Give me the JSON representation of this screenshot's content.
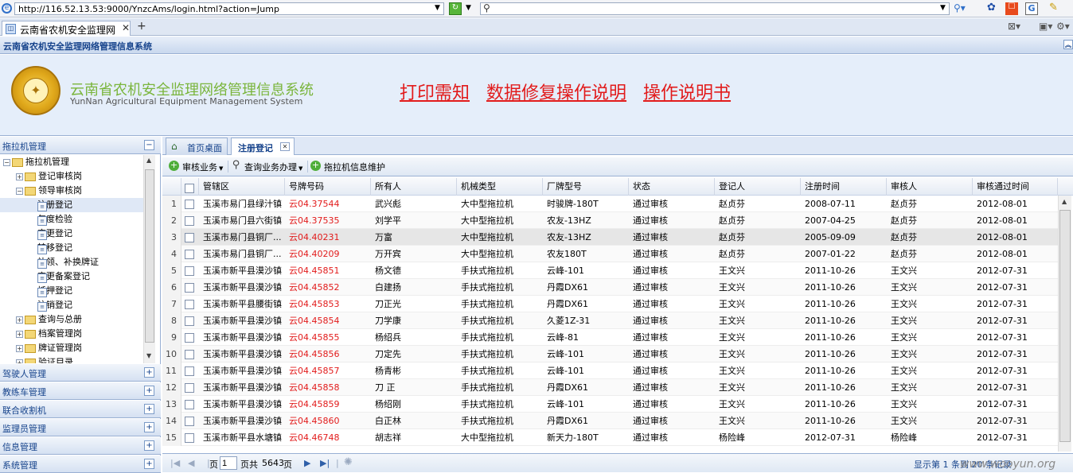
{
  "browser": {
    "url": "http://116.52.13.53:9000/YnzcAms/login.html?action=Jump",
    "tab_title": "云南省农机安全监理网"
  },
  "app": {
    "system_bar_title": "云南省农机安全监理网络管理信息系统",
    "title_cn": "云南省农机安全监理网络管理信息系统",
    "title_en": "YunNan Agricultural Equipment Management System",
    "header_links": [
      "打印需知",
      "数据修复操作说明",
      "操作说明书"
    ]
  },
  "sidebar": {
    "panels": [
      {
        "label": "拖拉机管理",
        "state": "−"
      },
      {
        "label": "驾驶人管理",
        "state": "+"
      },
      {
        "label": "教练车管理",
        "state": "+"
      },
      {
        "label": "联合收割机",
        "state": "+"
      },
      {
        "label": "监理员管理",
        "state": "+"
      },
      {
        "label": "信息管理",
        "state": "+"
      },
      {
        "label": "系统管理",
        "state": "+"
      }
    ],
    "tree": [
      {
        "label": "拖拉机管理",
        "level": 0,
        "type": "folder",
        "toggle": "−"
      },
      {
        "label": "登记审核岗",
        "level": 1,
        "type": "folder",
        "toggle": "+"
      },
      {
        "label": "领导审核岗",
        "level": 1,
        "type": "folder",
        "toggle": "−"
      },
      {
        "label": "注册登记",
        "level": 2,
        "type": "page",
        "selected": true
      },
      {
        "label": "年度检验",
        "level": 2,
        "type": "page"
      },
      {
        "label": "变更登记",
        "level": 2,
        "type": "page"
      },
      {
        "label": "转移登记",
        "level": 2,
        "type": "page"
      },
      {
        "label": "补领、补换牌证",
        "level": 2,
        "type": "page"
      },
      {
        "label": "变更备案登记",
        "level": 2,
        "type": "page"
      },
      {
        "label": "抵押登记",
        "level": 2,
        "type": "page"
      },
      {
        "label": "注销登记",
        "level": 2,
        "type": "page"
      },
      {
        "label": "查询与总册",
        "level": 1,
        "type": "folder",
        "toggle": "+"
      },
      {
        "label": "档案管理岗",
        "level": 1,
        "type": "folder",
        "toggle": "+"
      },
      {
        "label": "牌证管理岗",
        "level": 1,
        "type": "folder",
        "toggle": "+"
      },
      {
        "label": "验证目录",
        "level": 1,
        "type": "folder",
        "toggle": "+"
      }
    ]
  },
  "main_tabs": [
    {
      "label": "首页桌面"
    },
    {
      "label": "注册登记"
    }
  ],
  "toolbar": [
    {
      "label": "审核业务",
      "icon": "add-icon",
      "dropdown": true
    },
    {
      "label": "查询业务办理",
      "icon": "search-icon",
      "dropdown": true
    },
    {
      "label": "拖拉机信息维护",
      "icon": "add-icon",
      "dropdown": false
    }
  ],
  "grid": {
    "columns": [
      "管辖区",
      "号牌号码",
      "所有人",
      "机械类型",
      "厂牌型号",
      "状态",
      "登记人",
      "注册时间",
      "审核人",
      "审核通过时间"
    ],
    "rows": [
      [
        "玉溪市易门县绿汁镇",
        "云04.37544",
        "武兴彪",
        "大中型拖拉机",
        "时骏牌-180T",
        "通过审核",
        "赵贞芬",
        "2008-07-11",
        "赵贞芬",
        "2012-08-01"
      ],
      [
        "玉溪市易门县六街镇",
        "云04.37535",
        "刘学平",
        "大中型拖拉机",
        "农友-13HZ",
        "通过审核",
        "赵贞芬",
        "2007-04-25",
        "赵贞芬",
        "2012-08-01"
      ],
      [
        "玉溪市易门县铜厂...",
        "云04.40231",
        "万富",
        "大中型拖拉机",
        "农友-13HZ",
        "通过审核",
        "赵贞芬",
        "2005-09-09",
        "赵贞芬",
        "2012-08-01"
      ],
      [
        "玉溪市易门县铜厂...",
        "云04.40209",
        "万开宾",
        "大中型拖拉机",
        "农友180T",
        "通过审核",
        "赵贞芬",
        "2007-01-22",
        "赵贞芬",
        "2012-08-01"
      ],
      [
        "玉溪市新平县漠沙镇",
        "云04.45851",
        "杨文德",
        "手扶式拖拉机",
        "云峰-101",
        "通过审核",
        "王文兴",
        "2011-10-26",
        "王文兴",
        "2012-07-31"
      ],
      [
        "玉溪市新平县漠沙镇",
        "云04.45852",
        "白建扬",
        "手扶式拖拉机",
        "丹霞DX61",
        "通过审核",
        "王文兴",
        "2011-10-26",
        "王文兴",
        "2012-07-31"
      ],
      [
        "玉溪市新平县腰街镇",
        "云04.45853",
        "刀正光",
        "手扶式拖拉机",
        "丹霞DX61",
        "通过审核",
        "王文兴",
        "2011-10-26",
        "王文兴",
        "2012-07-31"
      ],
      [
        "玉溪市新平县漠沙镇",
        "云04.45854",
        "刀学康",
        "手扶式拖拉机",
        "久菱1Z-31",
        "通过审核",
        "王文兴",
        "2011-10-26",
        "王文兴",
        "2012-07-31"
      ],
      [
        "玉溪市新平县漠沙镇",
        "云04.45855",
        "杨绍兵",
        "手扶式拖拉机",
        "云峰-81",
        "通过审核",
        "王文兴",
        "2011-10-26",
        "王文兴",
        "2012-07-31"
      ],
      [
        "玉溪市新平县漠沙镇",
        "云04.45856",
        "刀定先",
        "手扶式拖拉机",
        "云峰-101",
        "通过审核",
        "王文兴",
        "2011-10-26",
        "王文兴",
        "2012-07-31"
      ],
      [
        "玉溪市新平县漠沙镇",
        "云04.45857",
        "杨青彬",
        "手扶式拖拉机",
        "云峰-101",
        "通过审核",
        "王文兴",
        "2011-10-26",
        "王文兴",
        "2012-07-31"
      ],
      [
        "玉溪市新平县漠沙镇",
        "云04.45858",
        "刀 正",
        "手扶式拖拉机",
        "丹霞DX61",
        "通过审核",
        "王文兴",
        "2011-10-26",
        "王文兴",
        "2012-07-31"
      ],
      [
        "玉溪市新平县漠沙镇",
        "云04.45859",
        "杨绍刚",
        "手扶式拖拉机",
        "云峰-101",
        "通过审核",
        "王文兴",
        "2011-10-26",
        "王文兴",
        "2012-07-31"
      ],
      [
        "玉溪市新平县漠沙镇",
        "云04.45860",
        "白正林",
        "手扶式拖拉机",
        "丹霞DX61",
        "通过审核",
        "王文兴",
        "2011-10-26",
        "王文兴",
        "2012-07-31"
      ],
      [
        "玉溪市新平县水塘镇",
        "云04.46748",
        "胡志祥",
        "大中型拖拉机",
        "新天力-180T",
        "通过审核",
        "杨险峰",
        "2012-07-31",
        "杨险峰",
        "2012-07-31"
      ]
    ],
    "highlighted_row": 3
  },
  "pager": {
    "page_label": "页",
    "page_value": "1",
    "total_prefix": "页共",
    "total_pages": "5643",
    "total_suffix": "页",
    "status": "显示第 1 条到 20 条记录"
  },
  "watermark": "www.wooyun.org"
}
